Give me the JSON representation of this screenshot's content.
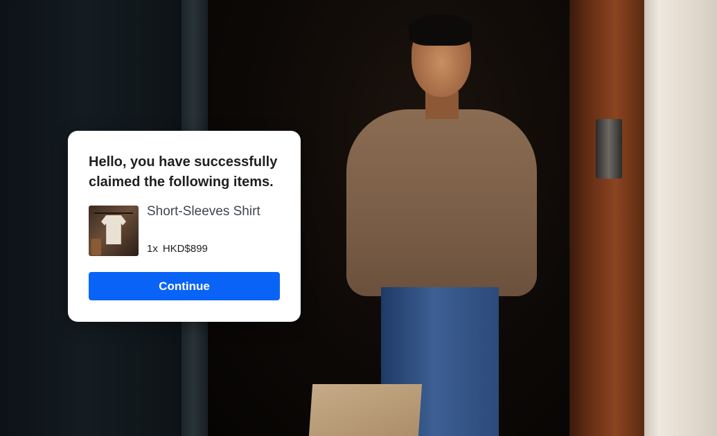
{
  "dialog": {
    "title": "Hello, you have successfully claimed the following items.",
    "item": {
      "name": "Short-Sleeves Shirt",
      "quantity": "1x",
      "price": "HKD$899"
    },
    "continue_label": "Continue"
  },
  "colors": {
    "button_bg": "#0a63f7",
    "button_text": "#ffffff",
    "card_bg": "#ffffff",
    "item_name_text": "#3d4650"
  }
}
